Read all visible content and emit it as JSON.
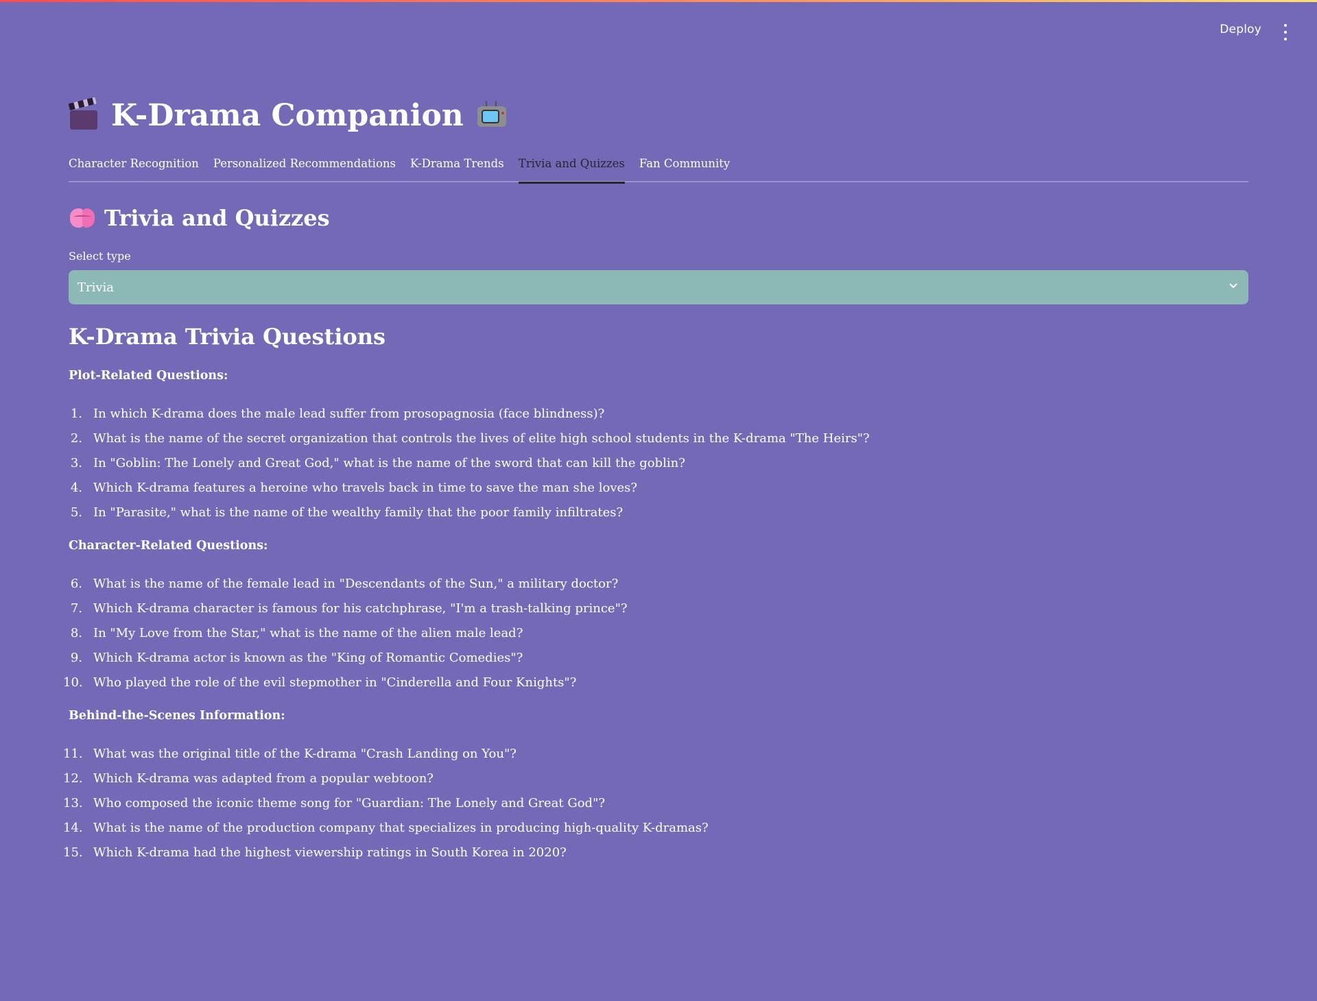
{
  "header": {
    "deploy_label": "Deploy",
    "menu_icon": "more-vertical-icon"
  },
  "app": {
    "title": "K-Drama Companion",
    "title_icon_left": "clapper-board-icon",
    "title_icon_right": "television-icon"
  },
  "tabs": [
    {
      "label": "Character Recognition",
      "active": false
    },
    {
      "label": "Personalized Recommendations",
      "active": false
    },
    {
      "label": "K-Drama Trends",
      "active": false
    },
    {
      "label": "Trivia and Quizzes",
      "active": true
    },
    {
      "label": "Fan Community",
      "active": false
    }
  ],
  "section": {
    "title": "Trivia and Quizzes",
    "icon": "brain-icon"
  },
  "select": {
    "label": "Select type",
    "value": "Trivia"
  },
  "content": {
    "title": "K-Drama Trivia Questions",
    "groups": [
      {
        "heading": "Plot-Related Questions:",
        "questions": [
          {
            "num": "1.",
            "text": "In which K-drama does the male lead suffer from prosopagnosia (face blindness)?"
          },
          {
            "num": "2.",
            "text": "What is the name of the secret organization that controls the lives of elite high school students in the K-drama \"The Heirs\"?"
          },
          {
            "num": "3.",
            "text": "In \"Goblin: The Lonely and Great God,\" what is the name of the sword that can kill the goblin?"
          },
          {
            "num": "4.",
            "text": "Which K-drama features a heroine who travels back in time to save the man she loves?"
          },
          {
            "num": "5.",
            "text": "In \"Parasite,\" what is the name of the wealthy family that the poor family infiltrates?"
          }
        ]
      },
      {
        "heading": "Character-Related Questions:",
        "questions": [
          {
            "num": "6.",
            "text": "What is the name of the female lead in \"Descendants of the Sun,\" a military doctor?"
          },
          {
            "num": "7.",
            "text": "Which K-drama character is famous for his catchphrase, \"I'm a trash-talking prince\"?"
          },
          {
            "num": "8.",
            "text": "In \"My Love from the Star,\" what is the name of the alien male lead?"
          },
          {
            "num": "9.",
            "text": "Which K-drama actor is known as the \"King of Romantic Comedies\"?"
          },
          {
            "num": "10.",
            "text": "Who played the role of the evil stepmother in \"Cinderella and Four Knights\"?"
          }
        ]
      },
      {
        "heading": "Behind-the-Scenes Information:",
        "questions": [
          {
            "num": "11.",
            "text": "What was the original title of the K-drama \"Crash Landing on You\"?"
          },
          {
            "num": "12.",
            "text": "Which K-drama was adapted from a popular webtoon?"
          },
          {
            "num": "13.",
            "text": "Who composed the iconic theme song for \"Guardian: The Lonely and Great God\"?"
          },
          {
            "num": "14.",
            "text": "What is the name of the production company that specializes in producing high-quality K-dramas?"
          },
          {
            "num": "15.",
            "text": "Which K-drama had the highest viewership ratings in South Korea in 2020?"
          }
        ]
      }
    ]
  },
  "colors": {
    "background": "#7469b6",
    "select_bg": "#8cb9b6",
    "active_tab": "#262730"
  }
}
